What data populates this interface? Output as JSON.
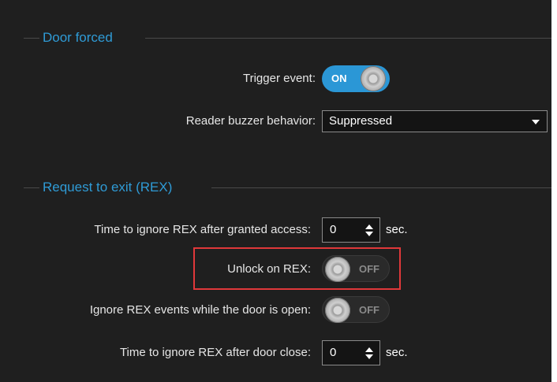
{
  "door_forced": {
    "title": "Door forced",
    "trigger_event": {
      "label": "Trigger event:",
      "state": "ON"
    },
    "reader_buzzer": {
      "label": "Reader buzzer behavior:",
      "value": "Suppressed"
    }
  },
  "rex": {
    "title": "Request to exit (REX)",
    "ignore_after_granted": {
      "label": "Time to ignore REX after granted access:",
      "value": "0",
      "unit": "sec."
    },
    "unlock_on_rex": {
      "label": "Unlock on REX:",
      "state": "OFF"
    },
    "ignore_while_open": {
      "label": "Ignore REX events while the door is open:",
      "state": "OFF"
    },
    "ignore_after_close": {
      "label": "Time to ignore REX after door close:",
      "value": "0",
      "unit": "sec."
    }
  },
  "colors": {
    "panel_background": "#1f1f1f",
    "section_title": "#2f9bd6",
    "toggle_on": "#2b97d6",
    "highlight_border": "#e0383a"
  },
  "icons": [
    "chevron-down-icon",
    "spinner-up-icon",
    "spinner-down-icon",
    "toggle-knob-icon"
  ]
}
